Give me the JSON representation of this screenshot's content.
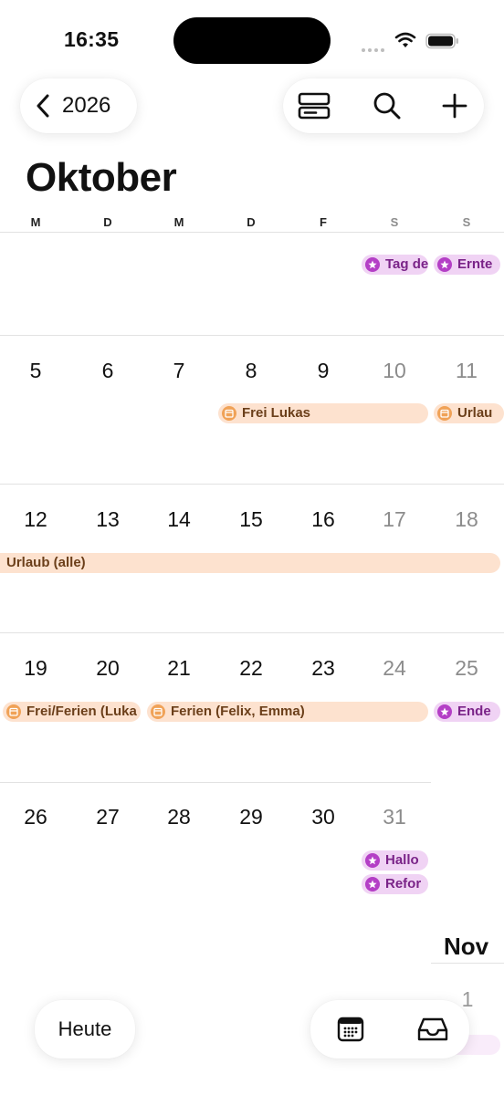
{
  "status": {
    "time": "16:35"
  },
  "nav": {
    "year_label": "2026"
  },
  "month_title": "Oktober",
  "weekdays": [
    "M",
    "D",
    "M",
    "D",
    "F",
    "S",
    "S"
  ],
  "weeks": [
    {
      "days": [
        "5",
        "6",
        "7",
        "8",
        "9",
        "10",
        "11"
      ]
    },
    {
      "days": [
        "12",
        "13",
        "14",
        "15",
        "16",
        "17",
        "18"
      ]
    },
    {
      "days": [
        "19",
        "20",
        "21",
        "22",
        "23",
        "24",
        "25"
      ]
    },
    {
      "days": [
        "26",
        "27",
        "28",
        "29",
        "30",
        "31"
      ]
    }
  ],
  "events": {
    "w0_sat": "Tag de",
    "w0_sun": "Ernte",
    "w1_frei": "Frei Lukas",
    "w1_urlaub": "Urlau",
    "w2_urlaub": "Urlaub (alle)",
    "w3_frei": "Frei/Ferien (Luka",
    "w3_ferien": "Ferien (Felix, Emma)",
    "w3_ende": "Ende",
    "w4_hallo": "Hallo",
    "w4_refor": "Refor"
  },
  "next_month": {
    "name": "Nov",
    "day": "1"
  },
  "bottom": {
    "today_label": "Heute"
  },
  "colors": {
    "peach": "#fde2cf",
    "purple": "#f0d3f4",
    "peach_icon": "#f0a257",
    "purple_icon": "#b43fc6"
  }
}
